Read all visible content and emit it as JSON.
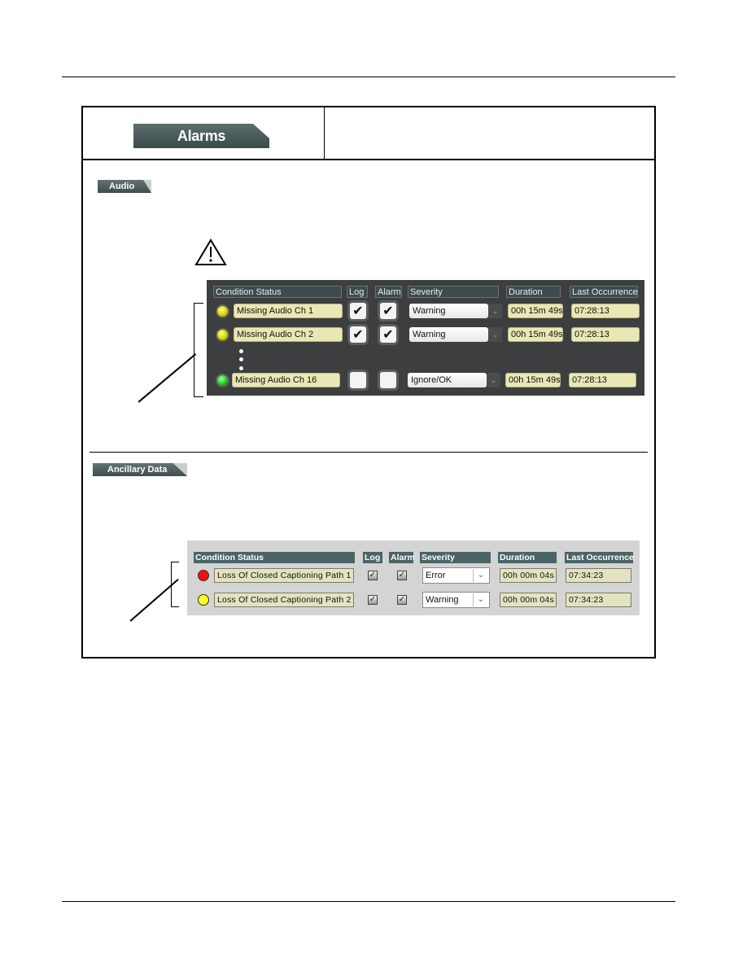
{
  "page": {
    "header_tab": "Alarms",
    "sections": {
      "audio": {
        "tab_label": "Audio",
        "warning_icon": "warning-triangle-icon",
        "columns": [
          "Condition Status",
          "Log",
          "Alarm",
          "Severity",
          "Duration",
          "Last Occurrence"
        ],
        "rows": [
          {
            "status_color": "yellow",
            "condition": "Missing Audio Ch 1",
            "log": true,
            "alarm": true,
            "severity": "Warning",
            "duration": "00h 15m 49s",
            "last_occurrence": "07:28:13"
          },
          {
            "status_color": "yellow",
            "condition": "Missing Audio Ch 2",
            "log": true,
            "alarm": true,
            "severity": "Warning",
            "duration": "00h 15m 49s",
            "last_occurrence": "07:28:13"
          },
          {
            "status_color": "green",
            "condition": "Missing Audio Ch 16",
            "log": false,
            "alarm": false,
            "severity": "Ignore/OK",
            "duration": "00h 15m 49s",
            "last_occurrence": "07:28:13"
          }
        ]
      },
      "ancillary": {
        "tab_label": "Ancillary Data",
        "columns": [
          "Condition Status",
          "Log",
          "Alarm",
          "Severity",
          "Duration",
          "Last Occurrence"
        ],
        "rows": [
          {
            "status_color": "red",
            "condition": "Loss Of Closed Captioning Path 1",
            "log": true,
            "alarm": true,
            "severity": "Error",
            "duration": "00h 00m 04s",
            "last_occurrence": "07:34:23"
          },
          {
            "status_color": "yellow",
            "condition": "Loss Of Closed Captioning Path 2",
            "log": true,
            "alarm": true,
            "severity": "Warning",
            "duration": "00h 00m 04s",
            "last_occurrence": "07:34:23"
          }
        ]
      }
    },
    "colors": {
      "red": "#ee1111",
      "yellow": "#ffff22",
      "green": "#22cc22"
    },
    "checkmark": "✔",
    "light_checkmark": "☑",
    "chevron": "⌄"
  }
}
